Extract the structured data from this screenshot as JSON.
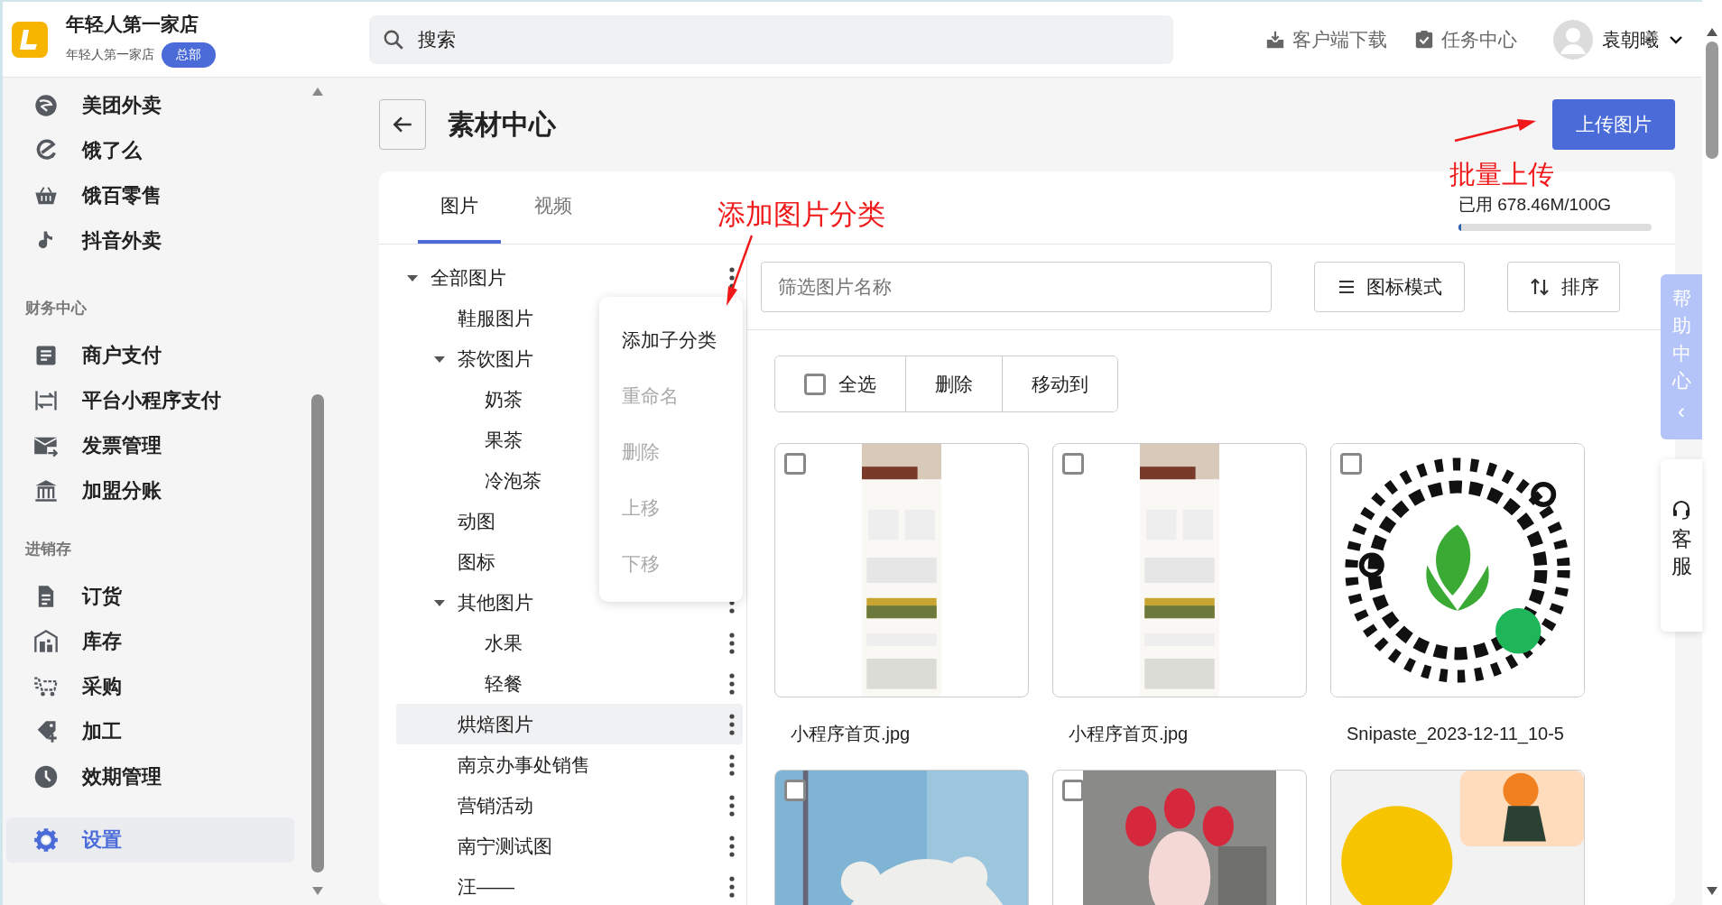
{
  "header": {
    "store_name": "年轻人第一家店",
    "store_subtitle": "年轻人第一家店",
    "badge": "总部",
    "search": {
      "placeholder": "搜索"
    },
    "actions": [
      {
        "label": "客户端下载"
      },
      {
        "label": "任务中心"
      }
    ],
    "user": "袁朝曦"
  },
  "sidebar": {
    "sections": [
      {
        "items": [
          {
            "label": "美团外卖",
            "selected": false
          },
          {
            "label": "饿了么",
            "selected": false
          },
          {
            "label": "饿百零售",
            "selected": false
          },
          {
            "label": "抖音外卖",
            "selected": false
          }
        ]
      },
      {
        "title": "财务中心",
        "items": [
          {
            "label": "商户支付",
            "selected": false
          },
          {
            "label": "平台小程序支付",
            "selected": false
          },
          {
            "label": "发票管理",
            "selected": false
          },
          {
            "label": "加盟分账",
            "selected": false
          }
        ]
      },
      {
        "title": "进销存",
        "items": [
          {
            "label": "订货",
            "selected": false
          },
          {
            "label": "库存",
            "selected": false
          },
          {
            "label": "采购",
            "selected": false
          },
          {
            "label": "加工",
            "selected": false
          },
          {
            "label": "效期管理",
            "selected": false
          }
        ]
      },
      {
        "items": [
          {
            "label": "设置",
            "selected": true
          }
        ]
      }
    ]
  },
  "page": {
    "title": "素材中心",
    "upload_button": "上传图片",
    "tabs": [
      {
        "label": "图片",
        "selected": true
      },
      {
        "label": "视频",
        "selected": false
      }
    ],
    "storage": {
      "text": "已用 678.46M/100G",
      "level": 0.01
    },
    "tree": [
      {
        "label": "全部图片",
        "selected": false,
        "expanded": true,
        "children": [
          {
            "label": "鞋服图片",
            "selected": false
          },
          {
            "label": "茶饮图片",
            "selected": false,
            "expanded": true,
            "children": [
              {
                "label": "奶茶",
                "selected": false
              },
              {
                "label": "果茶",
                "selected": false
              },
              {
                "label": "冷泡茶",
                "selected": false
              }
            ]
          },
          {
            "label": "动图",
            "selected": false
          },
          {
            "label": "图标",
            "selected": false
          },
          {
            "label": "其他图片",
            "selected": false,
            "expanded": true,
            "children": [
              {
                "label": "水果",
                "selected": false
              },
              {
                "label": "轻餐",
                "selected": false
              }
            ]
          },
          {
            "label": "烘焙图片",
            "selected": true
          },
          {
            "label": "南京办事处销售",
            "selected": false
          },
          {
            "label": "营销活动",
            "selected": false
          },
          {
            "label": "南宁测试图",
            "selected": false
          },
          {
            "label": "汪——",
            "selected": false
          }
        ]
      }
    ],
    "context_menu": [
      {
        "label": "添加子分类",
        "disabled": false
      },
      {
        "label": "重命名",
        "disabled": true
      },
      {
        "label": "删除",
        "disabled": true
      },
      {
        "label": "上移",
        "disabled": true
      },
      {
        "label": "下移",
        "disabled": true
      }
    ],
    "filter": {
      "placeholder": "筛选图片名称"
    },
    "view_button": "图标模式",
    "sort_button": "排序",
    "bulk": {
      "select_all": {
        "label": "全选",
        "checked": false
      },
      "delete": "删除",
      "move": "移动到"
    },
    "images": [
      {
        "kind": "picture",
        "caption": "小程序首页.jpg",
        "checked": false
      },
      {
        "kind": "picture",
        "caption": "小程序首页.jpg",
        "checked": false
      },
      {
        "kind": "picture",
        "caption": "Snipaste_2023-12-11_10-5",
        "checked": false
      },
      {
        "kind": "picture",
        "checked": false
      },
      {
        "kind": "picture",
        "checked": false
      },
      {
        "kind": "picture"
      }
    ]
  },
  "annotations": [
    {
      "text": "添加图片分类"
    },
    {
      "text": "批量上传"
    }
  ],
  "help": {
    "label": "帮助中心",
    "chevron": "‹"
  },
  "service": {
    "label": "客服"
  }
}
